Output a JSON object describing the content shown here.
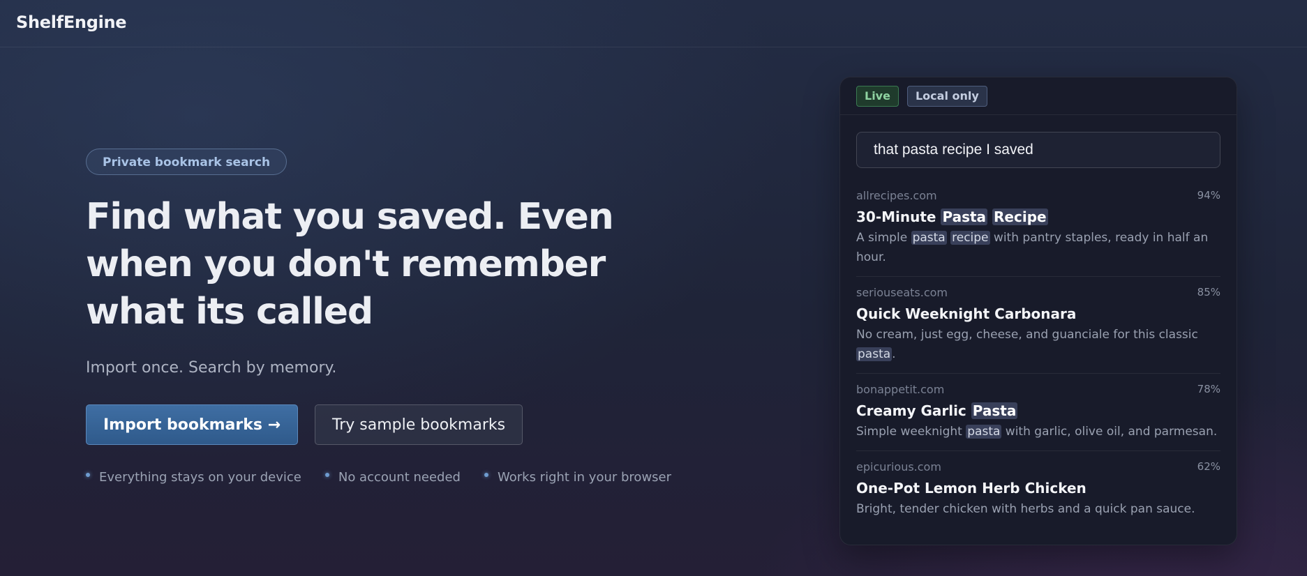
{
  "brand": "ShelfEngine",
  "hero": {
    "pill": "Private bookmark search",
    "headline": "Find what you saved. Even when you don't remember what its called",
    "subline": "Import once. Search by memory.",
    "primary_cta": "Import bookmarks →",
    "secondary_cta": "Try sample bookmarks",
    "features": [
      "Everything stays on your device",
      "No account needed",
      "Works right in your browser"
    ]
  },
  "demo": {
    "badges": {
      "live": "Live",
      "local": "Local only"
    },
    "search_value": "that pasta recipe I saved",
    "results": [
      {
        "domain": "allrecipes.com",
        "score": "94%",
        "title": [
          {
            "t": "30-Minute "
          },
          {
            "t": "Pasta",
            "hl": true
          },
          {
            "t": " "
          },
          {
            "t": "Recipe",
            "hl": true
          }
        ],
        "snippet": [
          {
            "t": "A simple "
          },
          {
            "t": "pasta",
            "hl": true
          },
          {
            "t": " "
          },
          {
            "t": "recipe",
            "hl": true
          },
          {
            "t": " with pantry staples, ready in half an hour."
          }
        ]
      },
      {
        "domain": "seriouseats.com",
        "score": "85%",
        "title": [
          {
            "t": "Quick Weeknight Carbonara"
          }
        ],
        "snippet": [
          {
            "t": "No cream, just egg, cheese, and guanciale for this classic "
          },
          {
            "t": "pasta",
            "hl": true
          },
          {
            "t": "."
          }
        ]
      },
      {
        "domain": "bonappetit.com",
        "score": "78%",
        "title": [
          {
            "t": "Creamy Garlic "
          },
          {
            "t": "Pasta",
            "hl": true
          }
        ],
        "snippet": [
          {
            "t": "Simple weeknight "
          },
          {
            "t": "pasta",
            "hl": true
          },
          {
            "t": " with garlic, olive oil, and parmesan."
          }
        ]
      },
      {
        "domain": "epicurious.com",
        "score": "62%",
        "title": [
          {
            "t": "One-Pot Lemon Herb Chicken"
          }
        ],
        "snippet": [
          {
            "t": "Bright, tender chicken with herbs and a quick pan sauce."
          }
        ]
      }
    ]
  }
}
